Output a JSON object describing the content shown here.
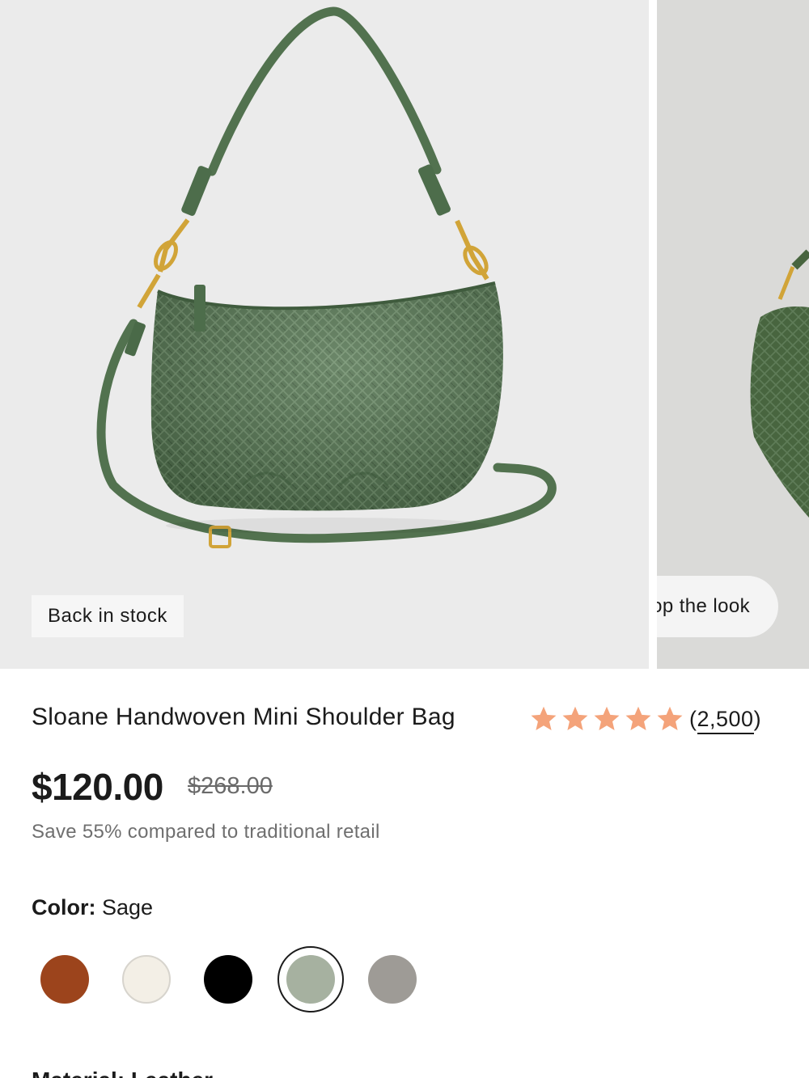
{
  "gallery": {
    "badge": "Back in stock",
    "shop_the_look": "Shop the look"
  },
  "product": {
    "title": "Sloane Handwoven Mini Shoulder Bag",
    "rating": {
      "stars": 5,
      "count": "2,500",
      "star_color": "#f4a37a"
    },
    "price": "$120.00",
    "original_price": "$268.00",
    "savings": "Save 55% compared to traditional retail"
  },
  "color": {
    "label": "Color:",
    "selected": "Sage",
    "swatches": [
      {
        "name": "Cognac",
        "hex": "#9c441c"
      },
      {
        "name": "Ivory",
        "hex": "#f3efe6"
      },
      {
        "name": "Black",
        "hex": "#000000"
      },
      {
        "name": "Sage",
        "hex": "#a6b1a0",
        "selected": true
      },
      {
        "name": "Grey",
        "hex": "#9e9b96"
      }
    ]
  },
  "next_section": {
    "heading": "Material: Leather"
  },
  "icons": [
    "star-icon",
    "product-image-bag"
  ],
  "colors": {
    "bag_green": "#51714f",
    "hardware_gold": "#d1a438",
    "photo_bg": "#ebebeb"
  }
}
